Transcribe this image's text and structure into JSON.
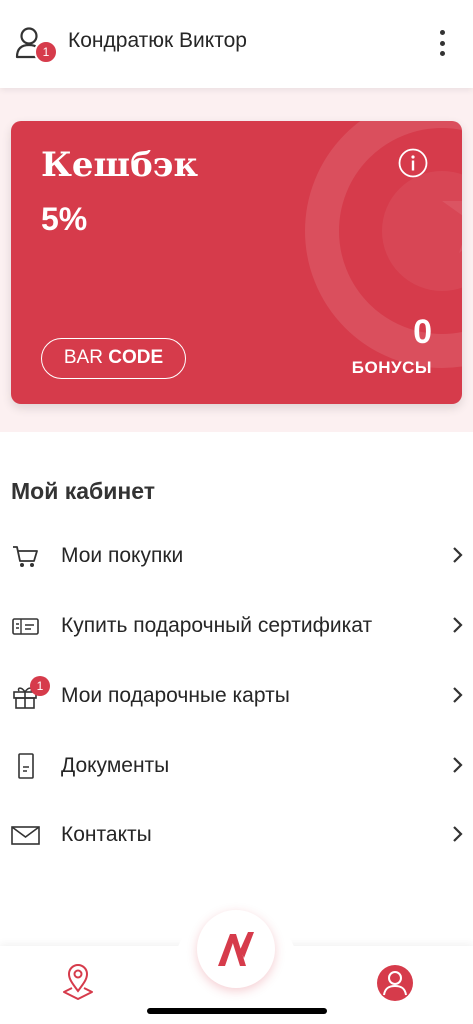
{
  "header": {
    "user_name": "Кондратюк Виктор",
    "notification_count": "1",
    "icons": [
      "user-icon",
      "more-vertical-icon"
    ]
  },
  "card": {
    "title": "Кешбэк",
    "percent": "5%",
    "barcode_prefix": "BAR",
    "barcode_bold": "CODE",
    "bonus_value": "0",
    "bonus_label": "БОНУСЫ",
    "color": "#d63b4b"
  },
  "cabinet": {
    "title": "Мой кабинет",
    "items": [
      {
        "label": "Мои покупки",
        "icon": "cart-icon"
      },
      {
        "label": "Купить подарочный сертификат",
        "icon": "certificate-icon"
      },
      {
        "label": "Мои подарочные карты",
        "icon": "gift-icon",
        "badge": "1"
      },
      {
        "label": "Документы",
        "icon": "document-icon"
      },
      {
        "label": "Контакты",
        "icon": "envelope-icon"
      }
    ]
  },
  "bottom_nav": {
    "items": [
      "location-pin-icon",
      "brand-logo",
      "profile-icon"
    ]
  }
}
